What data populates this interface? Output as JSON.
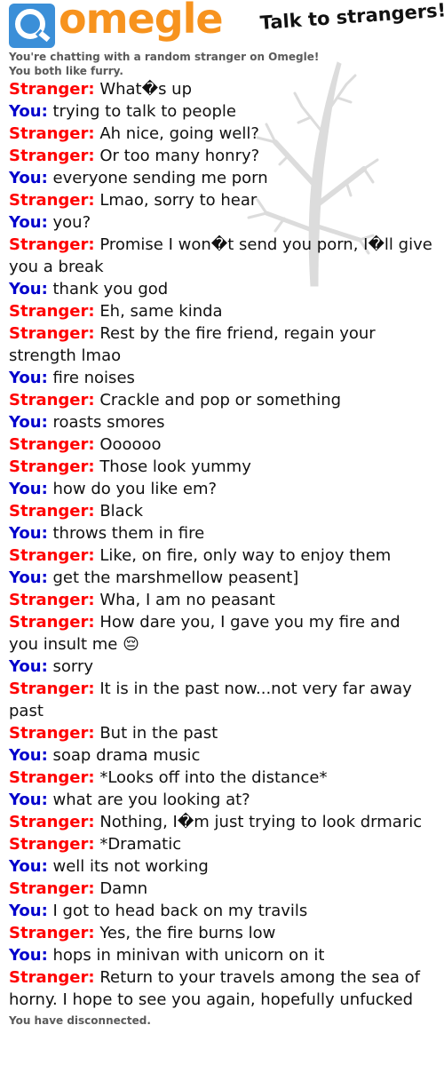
{
  "header": {
    "logo_text": "omegle",
    "tagline": "Talk to strangers!"
  },
  "status": {
    "line1": "You're chatting with a random stranger on Omegle!",
    "line2": "You both like furry.",
    "disconnected": "You have disconnected."
  },
  "colors": {
    "stranger": "#ff0000",
    "you": "#0000cc",
    "logo_orange": "#f7931e",
    "logo_blue": "#3b8fd8"
  },
  "messages": [
    {
      "speaker": "Stranger:",
      "text": "What�s up"
    },
    {
      "speaker": "You:",
      "text": "trying to talk to people"
    },
    {
      "speaker": "Stranger:",
      "text": "Ah nice, going well?"
    },
    {
      "speaker": "Stranger:",
      "text": "Or too many honry?"
    },
    {
      "speaker": "You:",
      "text": "everyone sending me porn"
    },
    {
      "speaker": "Stranger:",
      "text": "Lmao, sorry to hear"
    },
    {
      "speaker": "You:",
      "text": "you?"
    },
    {
      "speaker": "Stranger:",
      "text": "Promise I won�t send you porn, I�ll give you a break"
    },
    {
      "speaker": "You:",
      "text": "thank you god"
    },
    {
      "speaker": "Stranger:",
      "text": "Eh, same kinda"
    },
    {
      "speaker": "Stranger:",
      "text": "Rest by the fire friend, regain your strength lmao"
    },
    {
      "speaker": "You:",
      "text": "fire noises"
    },
    {
      "speaker": "Stranger:",
      "text": "Crackle and pop or something"
    },
    {
      "speaker": "You:",
      "text": "roasts smores"
    },
    {
      "speaker": "Stranger:",
      "text": "Oooooo"
    },
    {
      "speaker": "Stranger:",
      "text": "Those look yummy"
    },
    {
      "speaker": "You:",
      "text": "how do you like em?"
    },
    {
      "speaker": "Stranger:",
      "text": "Black"
    },
    {
      "speaker": "You:",
      "text": "throws them in fire"
    },
    {
      "speaker": "Stranger:",
      "text": "Like, on fire, only way to enjoy them"
    },
    {
      "speaker": "You:",
      "text": "get the marshmellow peasent]"
    },
    {
      "speaker": "Stranger:",
      "text": "Wha, I am no peasant"
    },
    {
      "speaker": "Stranger:",
      "text": "How dare you, I gave you my fire and you insult me 😔"
    },
    {
      "speaker": "You:",
      "text": "sorry"
    },
    {
      "speaker": "Stranger:",
      "text": "It is in the past now...not very far away past"
    },
    {
      "speaker": "Stranger:",
      "text": "But in the past"
    },
    {
      "speaker": "You:",
      "text": "soap drama music"
    },
    {
      "speaker": "Stranger:",
      "text": "*Looks off into the distance*"
    },
    {
      "speaker": "You:",
      "text": "what are you looking at?"
    },
    {
      "speaker": "Stranger:",
      "text": "Nothing, I�m just trying to look drmaric"
    },
    {
      "speaker": "Stranger:",
      "text": "*Dramatic"
    },
    {
      "speaker": "You:",
      "text": "well its not working"
    },
    {
      "speaker": "Stranger:",
      "text": "Damn"
    },
    {
      "speaker": "You:",
      "text": "I got to head back on my travils"
    },
    {
      "speaker": "Stranger:",
      "text": "Yes, the fire burns low"
    },
    {
      "speaker": "You:",
      "text": "hops in minivan with unicorn on it"
    },
    {
      "speaker": "Stranger:",
      "text": "Return to your travels among the sea of horny. I hope to see you again, hopefully unfucked"
    }
  ]
}
